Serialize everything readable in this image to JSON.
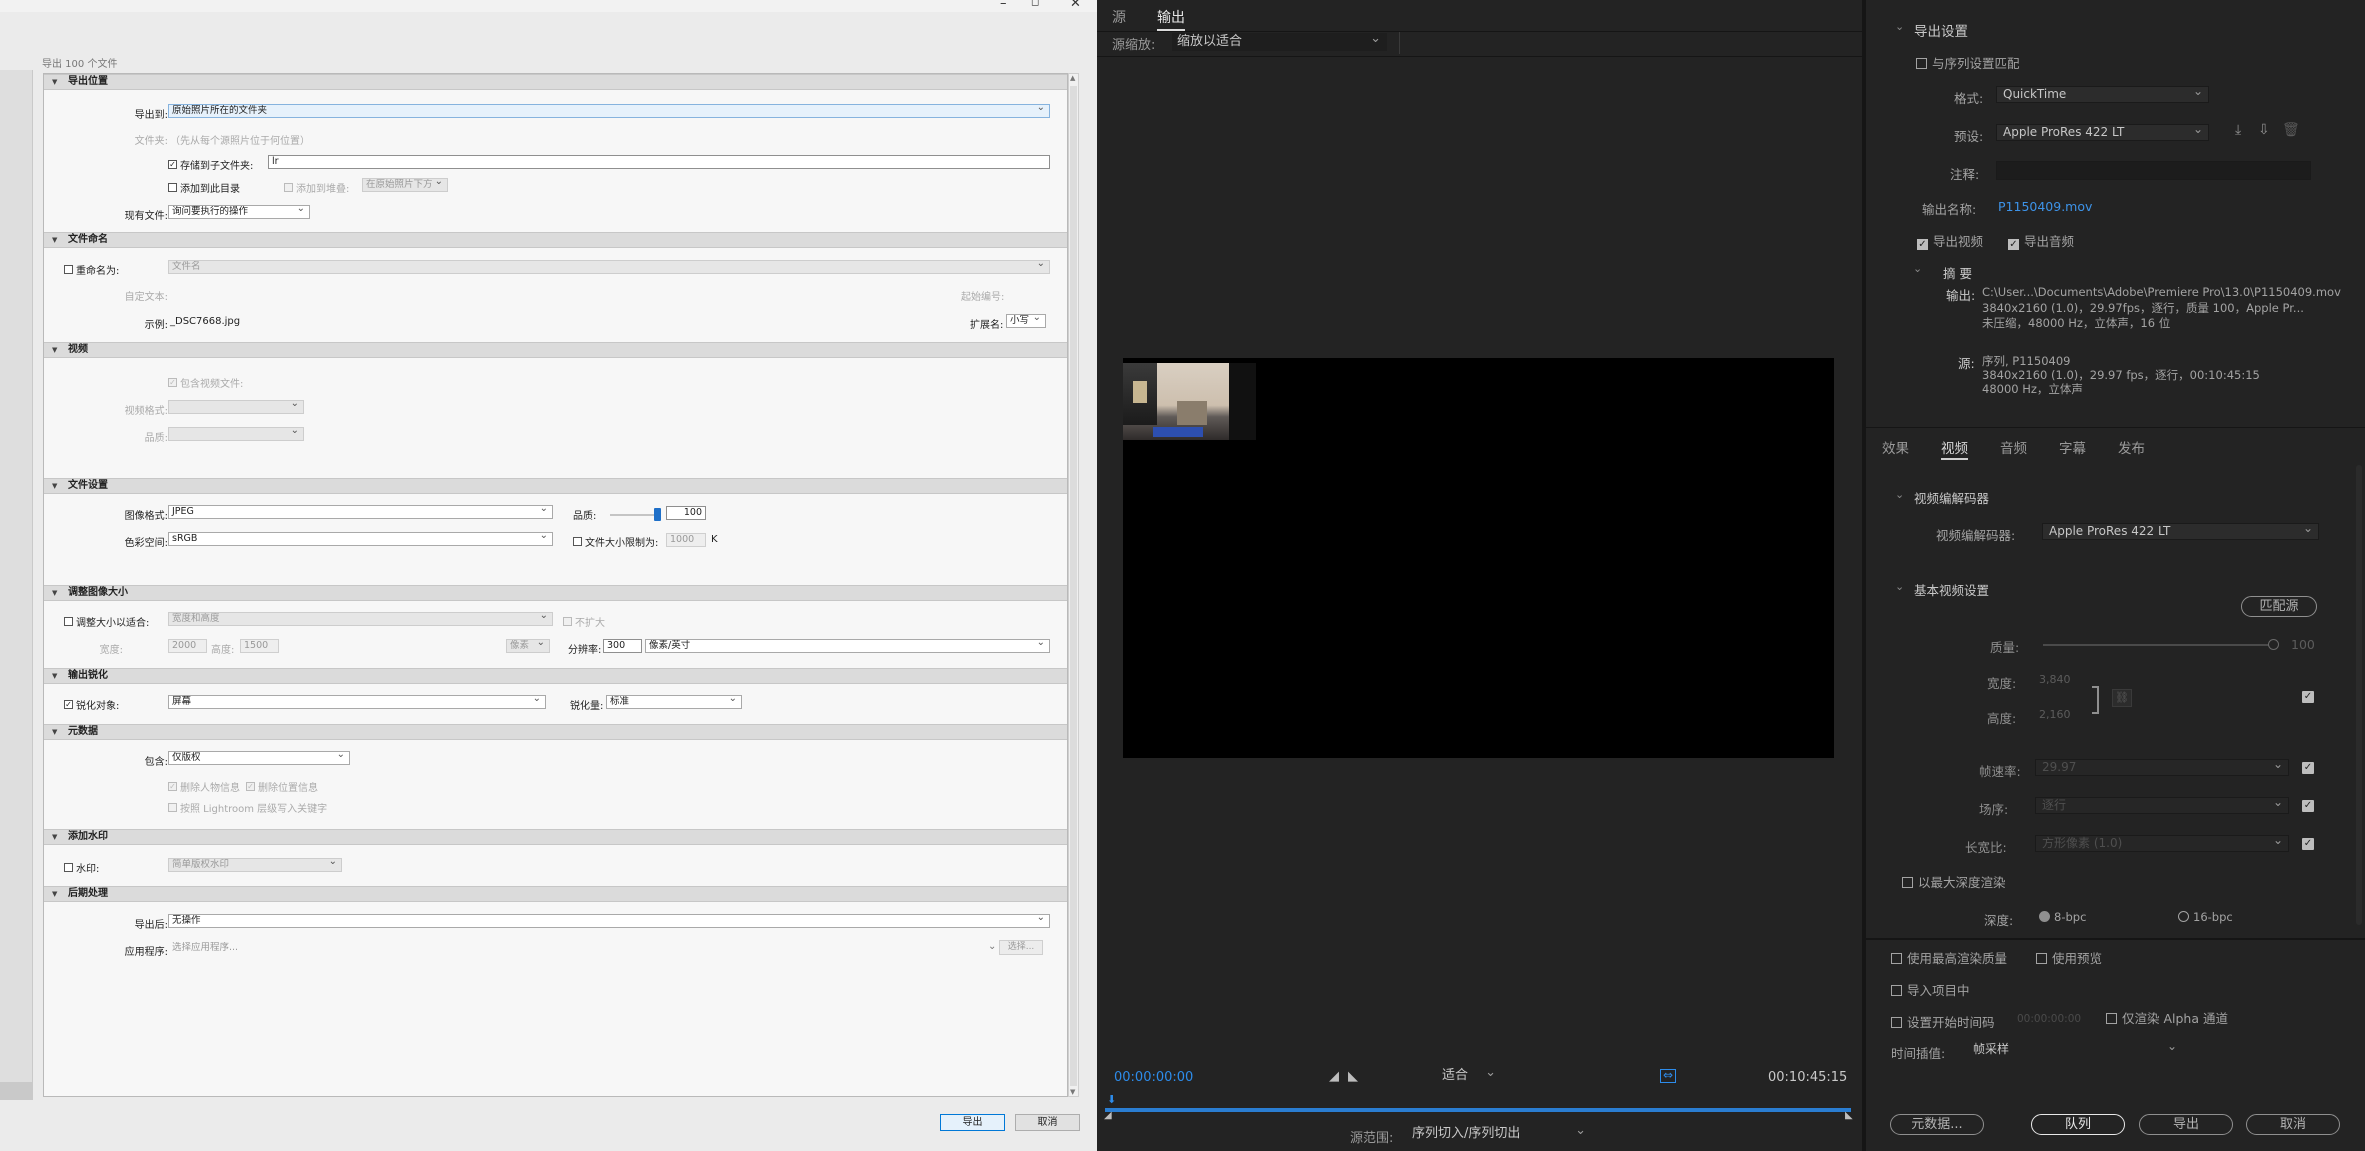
{
  "lr": {
    "subtitle": "导出 100 个文件",
    "sections": {
      "location": "导出位置",
      "naming": "文件命名",
      "video": "视频",
      "file_settings": "文件设置",
      "resize": "调整图像大小",
      "sharpen": "输出锐化",
      "metadata": "元数据",
      "watermark": "添加水印",
      "post": "后期处理"
    },
    "location": {
      "export_to_label": "导出到:",
      "export_to_value": "原始照片所在的文件夹",
      "folder_label": "文件夹:",
      "folder_hint": "（先从每个源照片位于何位置）",
      "subfolder_label": "存储到子文件夹:",
      "subfolder_value": "lr",
      "add_catalog_label": "添加到此目录",
      "add_stack_label": "添加到堆叠:",
      "stack_pos_value": "在原始照片下方",
      "existing_label": "现有文件:",
      "existing_value": "询问要执行的操作"
    },
    "naming": {
      "rename_label": "重命名为:",
      "rename_value": "文件名",
      "custom_text_label": "自定文本:",
      "start_number_label": "起始编号:",
      "example_label": "示例:",
      "example_value": "_DSC7668.jpg",
      "extension_label": "扩展名:",
      "extension_value": "小写"
    },
    "video": {
      "include_label": "包含视频文件:",
      "format_label": "视频格式:",
      "quality_label": "品质:"
    },
    "file_settings": {
      "format_label": "图像格式:",
      "format_value": "JPEG",
      "quality_label": "品质:",
      "quality_value": "100",
      "quality_fraction": 1.0,
      "colorspace_label": "色彩空间:",
      "colorspace_value": "sRGB",
      "limit_label": "文件大小限制为:",
      "limit_value": "1000",
      "limit_unit": "K"
    },
    "resize": {
      "fit_label": "调整大小以适合:",
      "fit_value": "宽度和高度",
      "no_enlarge_label": "不扩大",
      "width_label": "宽度:",
      "width_value": "2000",
      "height_label": "高度:",
      "height_value": "1500",
      "unit_value": "像素",
      "resolution_label": "分辨率:",
      "resolution_value": "300",
      "resolution_unit": "像素/英寸"
    },
    "sharpen": {
      "for_label": "锐化对象:",
      "for_value": "屏幕",
      "amount_label": "锐化量:",
      "amount_value": "标准"
    },
    "metadata": {
      "include_label": "包含:",
      "include_value": "仅版权",
      "remove_person_label": "删除人物信息",
      "remove_location_label": "删除位置信息",
      "hierarchy_label": "按照 Lightroom 层级写入关键字"
    },
    "watermark": {
      "label": "水印:",
      "value": "简单版权水印"
    },
    "post": {
      "after_label": "导出后:",
      "after_value": "无操作",
      "app_label": "应用程序:",
      "app_placeholder": "选择应用程序...",
      "choose_button": "选择..."
    },
    "buttons": {
      "export": "导出",
      "cancel": "取消"
    }
  },
  "pm": {
    "tabs": [
      "源",
      "输出"
    ],
    "source_scale_label": "源缩放:",
    "source_scale_value": "缩放以适合",
    "timecode_current": "00:00:00:00",
    "fit_value": "适合",
    "timecode_total": "00:10:45:15",
    "source_range_label": "源范围:",
    "source_range_value": "序列切入/序列切出"
  },
  "es": {
    "export_settings_title": "导出设置",
    "match_sequence_label": "与序列设置匹配",
    "format_label": "格式:",
    "format_value": "QuickTime",
    "preset_label": "预设:",
    "preset_value": "Apple ProRes 422 LT",
    "comments_label": "注释:",
    "output_name_label": "输出名称:",
    "output_name_value": "P1150409.mov",
    "export_video_label": "导出视频",
    "export_audio_label": "导出音频",
    "summary_title": "摘 要",
    "summary_output_label": "输出:",
    "summary_output_lines": [
      "C:\\User...\\Documents\\Adobe\\Premiere Pro\\13.0\\P1150409.mov",
      "3840x2160 (1.0)，29.97fps，逐行，质量 100，Apple Pr...",
      "未压缩，48000 Hz，立体声，16 位"
    ],
    "summary_source_label": "源:",
    "summary_source_lines": [
      "序列, P1150409",
      "3840x2160 (1.0)，29.97 fps，逐行，00:10:45:15",
      "48000 Hz，立体声"
    ],
    "tabs": [
      "效果",
      "视频",
      "音频",
      "字幕",
      "发布"
    ],
    "active_tab": "视频",
    "codec_section": "视频编解码器",
    "codec_label": "视频编解码器:",
    "codec_value": "Apple ProRes 422 LT",
    "basic_section": "基本视频设置",
    "match_source_button": "匹配源",
    "quality_label": "质量:",
    "quality_value": "100",
    "quality_fraction": 1.0,
    "width_label": "宽度:",
    "width_value": "3,840",
    "height_label": "高度:",
    "height_value": "2,160",
    "framerate_label": "帧速率:",
    "framerate_value": "29.97",
    "field_order_label": "场序:",
    "field_order_value": "逐行",
    "aspect_label": "长宽比:",
    "aspect_value": "方形像素 (1.0)",
    "max_depth_label": "以最大深度渲染",
    "depth_label": "深度:",
    "depth_8": "8-bpc",
    "depth_16": "16-bpc",
    "max_render_label": "使用最高渲染质量",
    "use_previews_label": "使用预览",
    "import_label": "导入项目中",
    "set_timecode_label": "设置开始时间码",
    "timecode_value": "00:00:00:00",
    "alpha_label": "仅渲染 Alpha 通道",
    "interp_label": "时间插值:",
    "interp_value": "帧采样",
    "buttons": {
      "metadata": "元数据...",
      "queue": "队列",
      "export": "导出",
      "cancel": "取消"
    }
  }
}
